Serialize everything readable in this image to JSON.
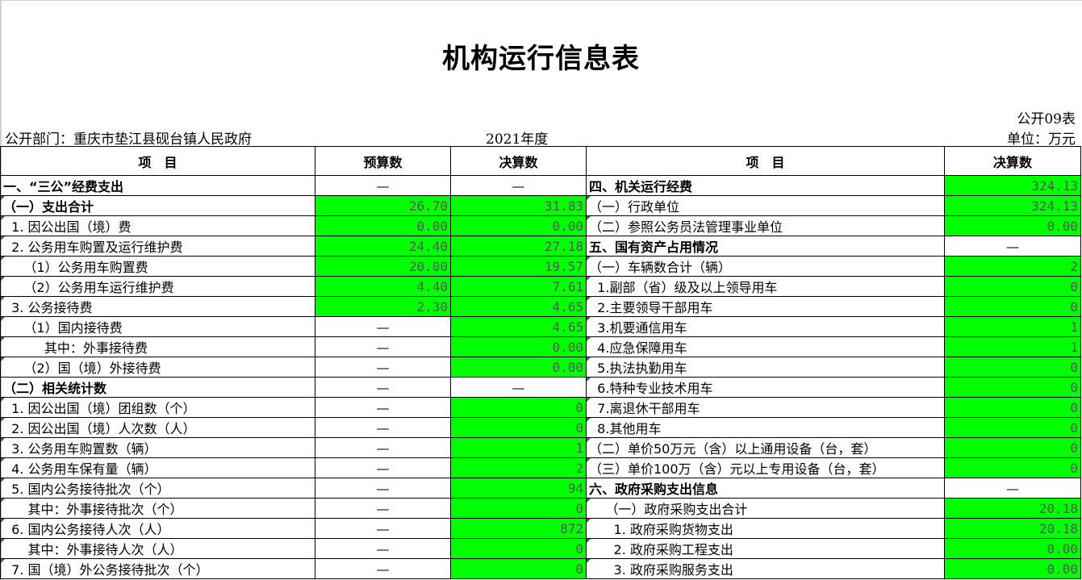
{
  "header": {
    "title": "机构运行信息表",
    "form_no": "公开09表",
    "department": "公开部门：重庆市垫江县砚台镇人民政府",
    "year": "2021年度",
    "unit": "单位：万元"
  },
  "columns": {
    "item": "项　目",
    "budget": "预算数",
    "final": "决算数",
    "item_r": "项　目",
    "final_r": "决算数"
  },
  "rows": [
    {
      "left": "一、“三公”经费支出",
      "budget": "—",
      "final": "—",
      "right": "四、机关运行经费",
      "rval": "324.13"
    },
    {
      "left": "（一）支出合计",
      "budget": "26.70",
      "final": "31.83",
      "right": "（一）行政单位",
      "rval": "324.13"
    },
    {
      "left": "  1. 因公出国（境）费",
      "budget": "0.00",
      "final": "0.00",
      "right": "（二）参照公务员法管理事业单位",
      "rval": "0.00"
    },
    {
      "left": "  2. 公务用车购置及运行维护费",
      "budget": "24.40",
      "final": "27.18",
      "right": "五、国有资产占用情况",
      "rval": "—"
    },
    {
      "left": "     （1）公务用车购置费",
      "budget": "20.00",
      "final": "19.57",
      "right": "（一）车辆数合计（辆）",
      "rval": "2"
    },
    {
      "left": "     （2）公务用车运行维护费",
      "budget": "4.40",
      "final": "7.61",
      "right": "  1.副部（省）级及以上领导用车",
      "rval": "0"
    },
    {
      "left": "  3. 公务接待费",
      "budget": "2.30",
      "final": "4.65",
      "right": "  2.主要领导干部用车",
      "rval": "0"
    },
    {
      "left": "     （1）国内接待费",
      "budget": "—",
      "final": "4.65",
      "right": "  3.机要通信用车",
      "rval": "1"
    },
    {
      "left": "          其中：外事接待费",
      "budget": "—",
      "final": "0.00",
      "right": "  4.应急保障用车",
      "rval": "1"
    },
    {
      "left": "     （2）国（境）外接待费",
      "budget": "—",
      "final": "0.00",
      "right": "  5.执法执勤用车",
      "rval": "0"
    },
    {
      "left": "（二）相关统计数",
      "budget": "—",
      "final": "—",
      "right": "  6.特种专业技术用车",
      "rval": "0"
    },
    {
      "left": "  1. 因公出国（境）团组数（个）",
      "budget": "—",
      "final": "0",
      "right": "  7.离退休干部用车",
      "rval": "0"
    },
    {
      "left": "  2. 因公出国（境）人次数（人）",
      "budget": "—",
      "final": "0",
      "right": "  8.其他用车",
      "rval": "0"
    },
    {
      "left": "  3. 公务用车购置数（辆）",
      "budget": "—",
      "final": "1",
      "right": "（二）单价50万元（含）以上通用设备（台，套）",
      "rval": "0"
    },
    {
      "left": "  4. 公务用车保有量（辆）",
      "budget": "—",
      "final": "2",
      "right": "（三）单价100万（含）元以上专用设备（台，套）",
      "rval": "0"
    },
    {
      "left": "  5. 国内公务接待批次（个）",
      "budget": "—",
      "final": "94",
      "right": "六、政府采购支出信息",
      "rval": "—"
    },
    {
      "left": "      其中：外事接待批次（个）",
      "budget": "—",
      "final": "0",
      "right": "    （一）政府采购支出合计",
      "rval": "20.18"
    },
    {
      "left": "  6. 国内公务接待人次（人）",
      "budget": "—",
      "final": "872",
      "right": "      1. 政府采购货物支出",
      "rval": "20.18"
    },
    {
      "left": "      其中：外事接待人次（人）",
      "budget": "—",
      "final": "0",
      "right": "      2. 政府采购工程支出",
      "rval": "0.00"
    },
    {
      "left": "  7. 国（境）外公务接待批次（个）",
      "budget": "—",
      "final": "0",
      "right": "      3. 政府采购服务支出",
      "rval": "0.00"
    }
  ],
  "colors": {
    "highlight": "#00ff00"
  }
}
